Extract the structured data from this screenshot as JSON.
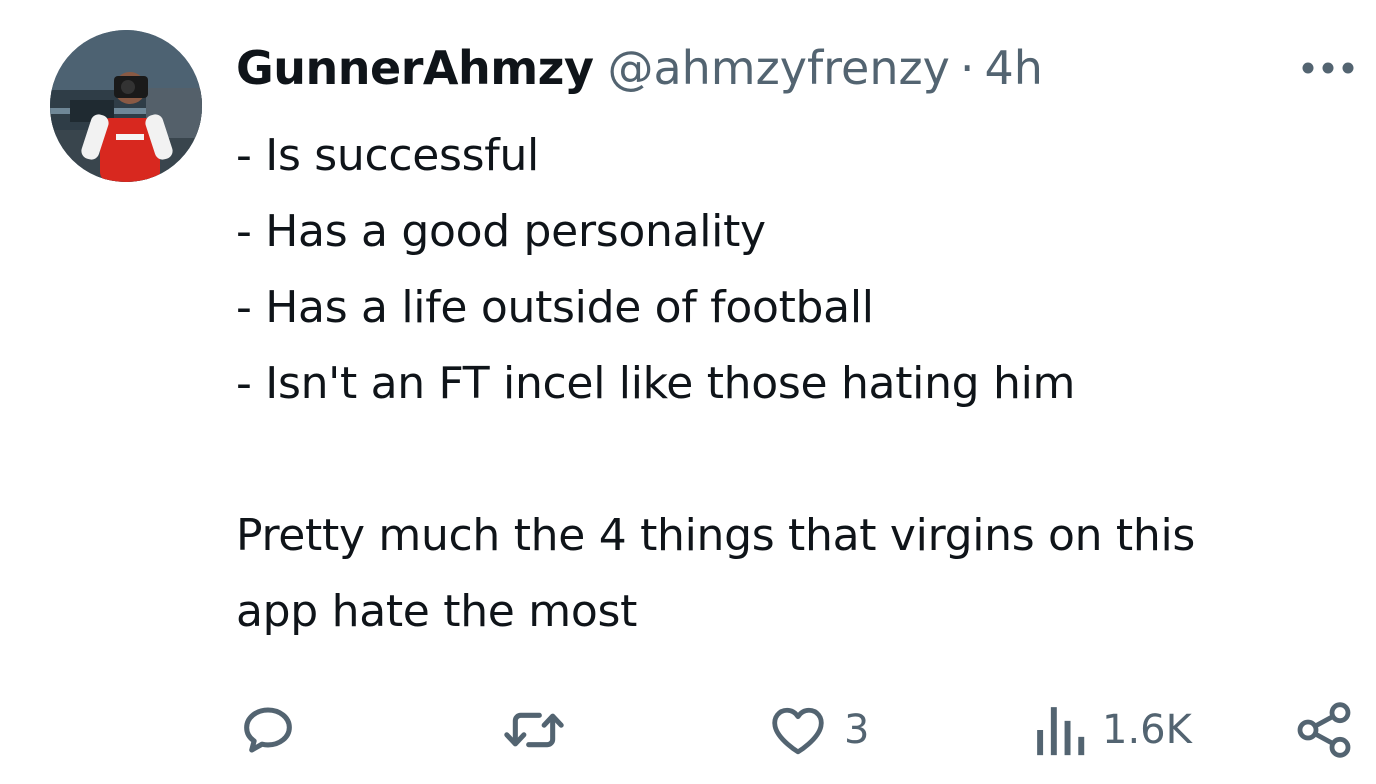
{
  "tweet": {
    "author": {
      "display_name": "GunnerAhmzy",
      "handle": "@ahmzyfrenzy",
      "separator": "·",
      "time": "4h"
    },
    "more_icon": "more-horizontal-icon",
    "text_lines": [
      "- Is successful",
      "- Has a good personality",
      "- Has a life outside of football",
      "- Isn't an FT incel like those hating him",
      "",
      "Pretty much the 4 things that virgins on this",
      "app hate the most"
    ],
    "actions": {
      "reply": {
        "icon": "reply-icon",
        "count": ""
      },
      "retweet": {
        "icon": "retweet-icon",
        "count": ""
      },
      "like": {
        "icon": "heart-icon",
        "count": "3"
      },
      "views": {
        "icon": "views-icon",
        "count": "1.6K"
      },
      "share": {
        "icon": "share-icon"
      }
    }
  },
  "colors": {
    "text_primary": "#0f1419",
    "text_secondary": "#536471",
    "background": "#ffffff"
  }
}
